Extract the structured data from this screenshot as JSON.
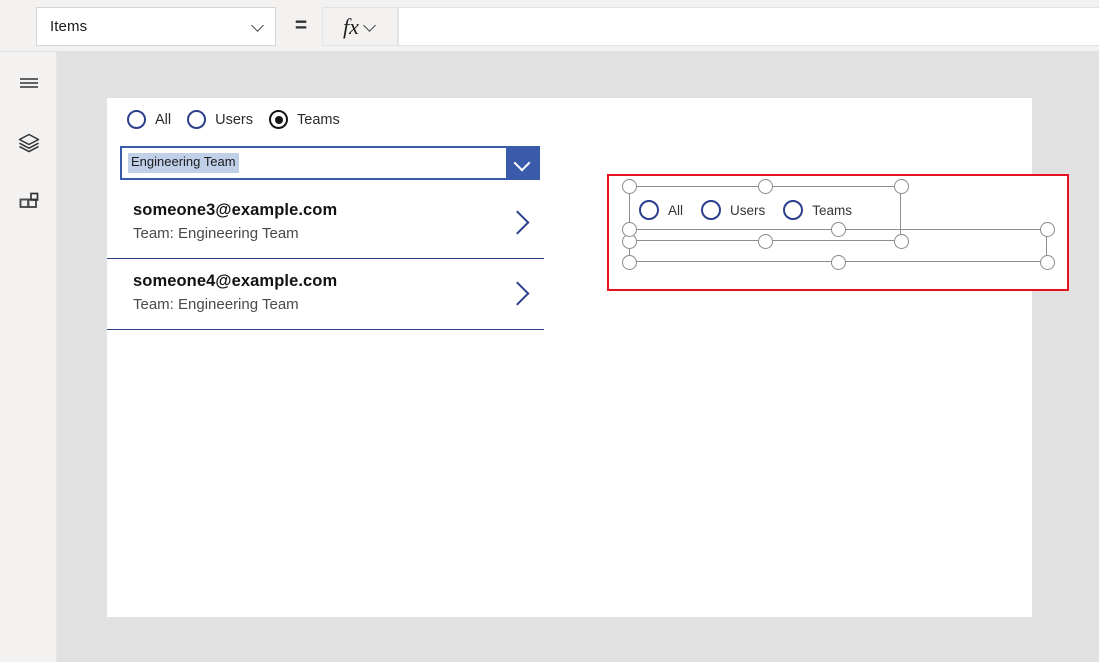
{
  "formula_bar": {
    "property_select": {
      "value": "Items",
      "chevron_icon": "chevron-down-icon"
    },
    "equals_sign": "=",
    "fx_button": {
      "glyph": "fx",
      "chevron_icon": "chevron-down-icon"
    },
    "formula_input": {
      "value": "",
      "placeholder": ""
    }
  },
  "left_rail": {
    "items": [
      {
        "name": "hamburger-menu-icon",
        "label": "Menu"
      },
      {
        "name": "tree-view-layers-icon",
        "label": "Tree view"
      },
      {
        "name": "insert-components-icon",
        "label": "Insert"
      }
    ]
  },
  "canvas": {
    "radio_group_live": {
      "name": "filter-radio-group",
      "options": [
        {
          "label": "All",
          "checked": false
        },
        {
          "label": "Users",
          "checked": false
        },
        {
          "label": "Teams",
          "checked": true
        }
      ]
    },
    "combobox": {
      "name": "team-combobox",
      "value": "Engineering Team",
      "placeholder": "",
      "chevron_icon": "chevron-down-icon"
    },
    "gallery": {
      "name": "people-gallery",
      "items": [
        {
          "title": "someone3@example.com",
          "subtitle": "Team: Engineering Team",
          "chevron_icon": "chevron-right-icon"
        },
        {
          "title": "someone4@example.com",
          "subtitle": "Team: Engineering Team",
          "chevron_icon": "chevron-right-icon"
        }
      ]
    },
    "selected_control": {
      "name": "selected-radio-group",
      "selection_border_color": "#e81123",
      "options": [
        {
          "label": "All",
          "checked": false
        },
        {
          "label": "Users",
          "checked": false
        },
        {
          "label": "Teams",
          "checked": false
        }
      ]
    }
  },
  "colors": {
    "accent_blue": "#2b3f8c",
    "combo_blue": "#3a5ba9",
    "selection_red": "#e81123",
    "canvas_grey": "#e1e1e1",
    "chrome_grey": "#f3f2f1"
  }
}
